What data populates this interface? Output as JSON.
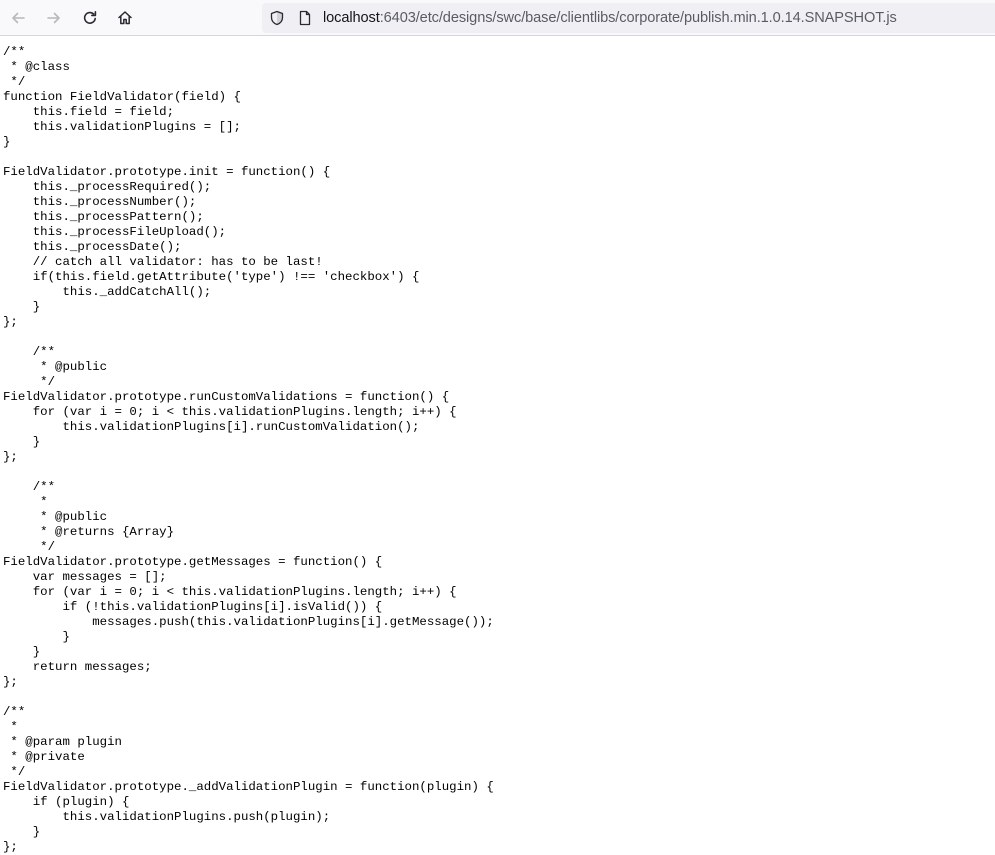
{
  "toolbar": {
    "back_icon": "arrow-left-icon",
    "forward_icon": "arrow-right-icon",
    "reload_icon": "reload-icon",
    "home_icon": "home-icon",
    "url_host": "localhost",
    "url_rest": ":6403/etc/designs/swc/base/clientlibs/corporate/publish.min.1.0.14.SNAPSHOT.js",
    "colors": {
      "toolbar_bg": "#f9f9fb",
      "urlbar_bg": "#f0f0f4",
      "url_host": "#15141a",
      "url_path": "#5b5b66"
    }
  },
  "code": {
    "lines": [
      "/**",
      " * @class",
      " */",
      "function FieldValidator(field) {",
      "    this.field = field;",
      "    this.validationPlugins = [];",
      "}",
      "",
      "FieldValidator.prototype.init = function() {",
      "    this._processRequired();",
      "    this._processNumber();",
      "    this._processPattern();",
      "    this._processFileUpload();",
      "    this._processDate();",
      "    // catch all validator: has to be last!",
      "    if(this.field.getAttribute('type') !== 'checkbox') {",
      "        this._addCatchAll();",
      "    }",
      "};",
      "",
      "    /**",
      "     * @public",
      "     */",
      "FieldValidator.prototype.runCustomValidations = function() {",
      "    for (var i = 0; i < this.validationPlugins.length; i++) {",
      "        this.validationPlugins[i].runCustomValidation();",
      "    }",
      "};",
      "",
      "    /**",
      "     *",
      "     * @public",
      "     * @returns {Array}",
      "     */",
      "FieldValidator.prototype.getMessages = function() {",
      "    var messages = [];",
      "    for (var i = 0; i < this.validationPlugins.length; i++) {",
      "        if (!this.validationPlugins[i].isValid()) {",
      "            messages.push(this.validationPlugins[i].getMessage());",
      "        }",
      "    }",
      "    return messages;",
      "};",
      "",
      "/**",
      " *",
      " * @param plugin",
      " * @private",
      " */",
      "FieldValidator.prototype._addValidationPlugin = function(plugin) {",
      "    if (plugin) {",
      "        this.validationPlugins.push(plugin);",
      "    }",
      "};"
    ]
  }
}
